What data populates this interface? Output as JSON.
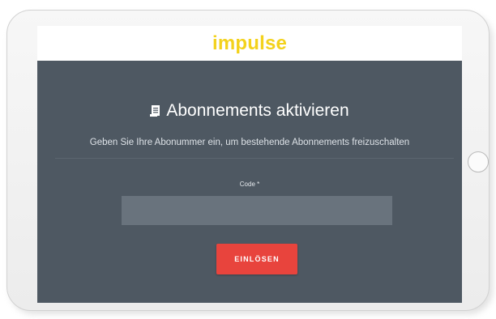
{
  "header": {
    "logo_text": "impulse",
    "logo_color": "#f3d21c"
  },
  "main": {
    "title_icon": "document-icon",
    "title": "Abonnements aktivieren",
    "subtitle": "Geben Sie Ihre Abonummer ein, um bestehende Abonnements freizuschalten",
    "code_label": "Code *",
    "code_value": "",
    "redeem_label": "EINLÖSEN"
  },
  "colors": {
    "screen_background": "#4e5862",
    "input_background": "#69737d",
    "button_accent": "#e8443d"
  }
}
